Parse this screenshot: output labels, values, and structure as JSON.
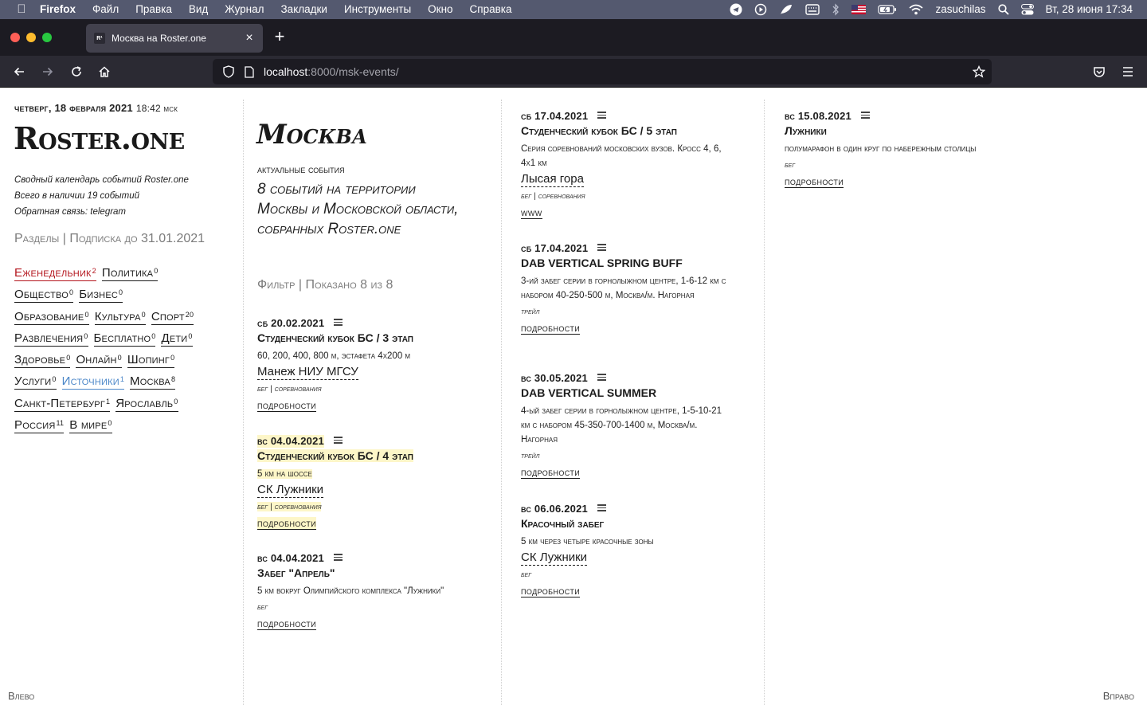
{
  "os_menubar": {
    "app_name": "Firefox",
    "menu_items": [
      "Файл",
      "Правка",
      "Вид",
      "Журнал",
      "Закладки",
      "Инструменты",
      "Окно",
      "Справка"
    ],
    "user": "zasuchilas",
    "datetime": "Вт, 28 июня  17:34"
  },
  "browser": {
    "tab_title": "Москва на Roster.one",
    "favicon_text": "R¹",
    "url_host": "localhost",
    "url_rest": ":8000/msk-events/"
  },
  "sidebar": {
    "date": "четверг, 18 февраля 2021",
    "time": "18:42 мск",
    "logo": "Roster.one",
    "about_lines": [
      "Сводный календарь событий Roster.one",
      "Всего в наличии 19 событий",
      "Обратная связь: telegram"
    ],
    "sections_heading": "Разделы | Подписка до 31.01.2021",
    "tags": [
      [
        {
          "label": "Еженедельник",
          "count": "2",
          "style": "red"
        },
        {
          "label": "Политика",
          "count": "0"
        }
      ],
      [
        {
          "label": "Общество",
          "count": "0"
        },
        {
          "label": "Бизнес",
          "count": "0"
        }
      ],
      [
        {
          "label": "Образование",
          "count": "0"
        },
        {
          "label": "Культура",
          "count": "0"
        },
        {
          "label": "Спорт",
          "count": "20"
        }
      ],
      [
        {
          "label": "Развлечения",
          "count": "0"
        },
        {
          "label": "Бесплатно",
          "count": "0"
        },
        {
          "label": "Дети",
          "count": "0"
        }
      ],
      [
        {
          "label": "Здоровье",
          "count": "0"
        },
        {
          "label": "Онлайн",
          "count": "0"
        },
        {
          "label": "Шопинг",
          "count": "0"
        }
      ],
      [
        {
          "label": "Услуги",
          "count": "0"
        },
        {
          "label": "Источники",
          "count": "1",
          "style": "blue"
        },
        {
          "label": "Москва",
          "count": "8"
        }
      ],
      [
        {
          "label": "Санкт-Петербург",
          "count": "1"
        },
        {
          "label": "Ярославль",
          "count": "0"
        }
      ],
      [
        {
          "label": "Россия",
          "count": "11"
        },
        {
          "label": "В мире",
          "count": "0"
        }
      ]
    ]
  },
  "city": {
    "title": "Москва",
    "subtitle": "актуальные события",
    "description": "8 событий на территории Москвы и Московской области, собранных Roster.one",
    "filter_heading": "Фильтр | Показано 8 из 8"
  },
  "events": [
    {
      "date": "сб 20.02.2021",
      "title": "Студенческий кубок БС / 3 этап",
      "desc": "60, 200, 400, 800 м, эстафета 4х200 м",
      "venue": "Манеж НИУ МГСУ",
      "type": "бег | соревнования",
      "link": "подробности"
    },
    {
      "date": "вс 04.04.2021",
      "title": "Студенческий кубок БС / 4 этап",
      "desc": "5 км на шоссе",
      "venue": "СК Лужники",
      "type": "бег | соревнования",
      "link": "подробности",
      "highlight": true
    },
    {
      "date": "вс 04.04.2021",
      "title": "Забег \"Апрель\"",
      "desc": "5 км вокруг Олимпийского комплекса \"Лужники\"",
      "type": "бег",
      "link": "подробности"
    },
    {
      "date": "сб 17.04.2021",
      "title": "Студенческий кубок БС / 5 этап",
      "desc": "Серия соревнований московских вузов. Кросс 4, 6, 4х1 км",
      "venue": "Лысая гора",
      "type": "бег | соревнования",
      "link": "www"
    },
    {
      "date": "сб 17.04.2021",
      "title": "DAB VERTICAL SPRING BUFF",
      "desc": "3-ий забег серии в горнолыжном центре, 1-6-12 км с набором 40-250-500 м, Москва/м. Нагорная",
      "type": "трейл",
      "link": "подробности"
    },
    {
      "date": "вс 30.05.2021",
      "title": "DAB VERTICAL SUMMER",
      "desc": "4-ый забег серии в горнолыжном центре, 1-5-10-21 км с набором 45-350-700-1400 м, Москва/м. Нагорная",
      "type": "трейл",
      "link": "подробности"
    },
    {
      "date": "вс 06.06.2021",
      "title": "Красочный забег",
      "desc": "5 км через четыре красочные зоны",
      "venue": "СК Лужники",
      "type": "бег",
      "link": "подробности"
    },
    {
      "date": "вс 15.08.2021",
      "title": "Лужники",
      "desc": "полумарафон в один круг по набережным столицы",
      "type": "бег",
      "link": "подробности"
    }
  ],
  "footer": {
    "left": "Влево",
    "right": "Вправо"
  }
}
